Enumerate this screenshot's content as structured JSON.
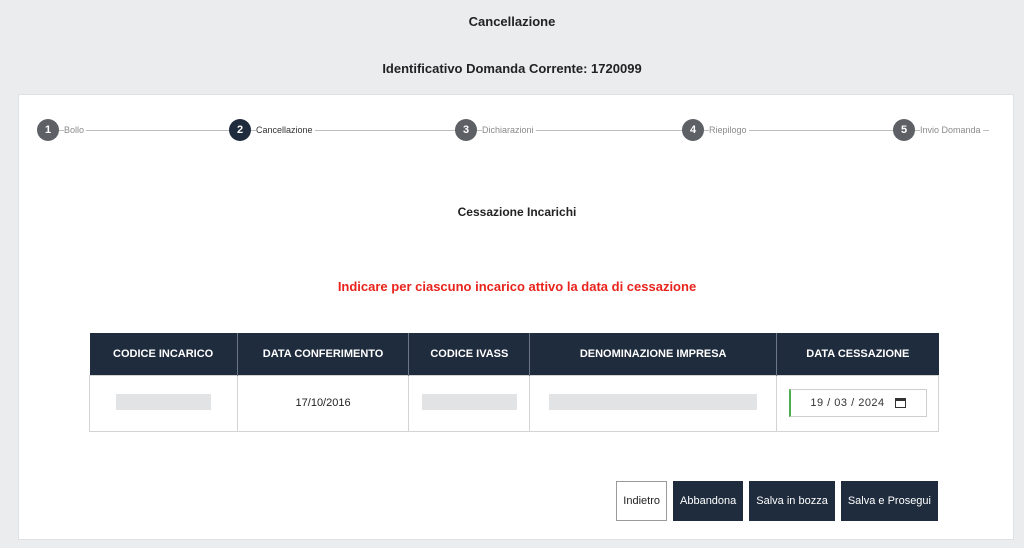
{
  "header": {
    "title": "Cancellazione",
    "identifier": "Identificativo Domanda Corrente: 1720099"
  },
  "stepper": [
    {
      "number": "1",
      "label": "Bollo"
    },
    {
      "number": "2",
      "label": "Cancellazione"
    },
    {
      "number": "3",
      "label": "Dichiarazioni"
    },
    {
      "number": "4",
      "label": "Riepilogo"
    },
    {
      "number": "5",
      "label": "Invio Domanda"
    }
  ],
  "section_title": "Cessazione Incarichi",
  "warning": "Indicare per ciascuno incarico attivo la data di cessazione",
  "table": {
    "headers": [
      "CODICE INCARICO",
      "DATA CONFERIMENTO",
      "CODICE IVASS",
      "DENOMINAZIONE IMPRESA",
      "DATA CESSAZIONE"
    ],
    "rows": [
      {
        "data_conferimento": "17/10/2016",
        "data_cessazione": "19 / 03 / 2024"
      }
    ]
  },
  "buttons": {
    "back": "Indietro",
    "abandon": "Abbandona",
    "save_draft": "Salva in bozza",
    "save_continue": "Salva e Prosegui"
  },
  "colors": {
    "primary": "#1f2c3e",
    "warning": "#e8231c",
    "valid_border": "#4caf50"
  },
  "icons": {
    "date_picker": "calendar-icon"
  }
}
